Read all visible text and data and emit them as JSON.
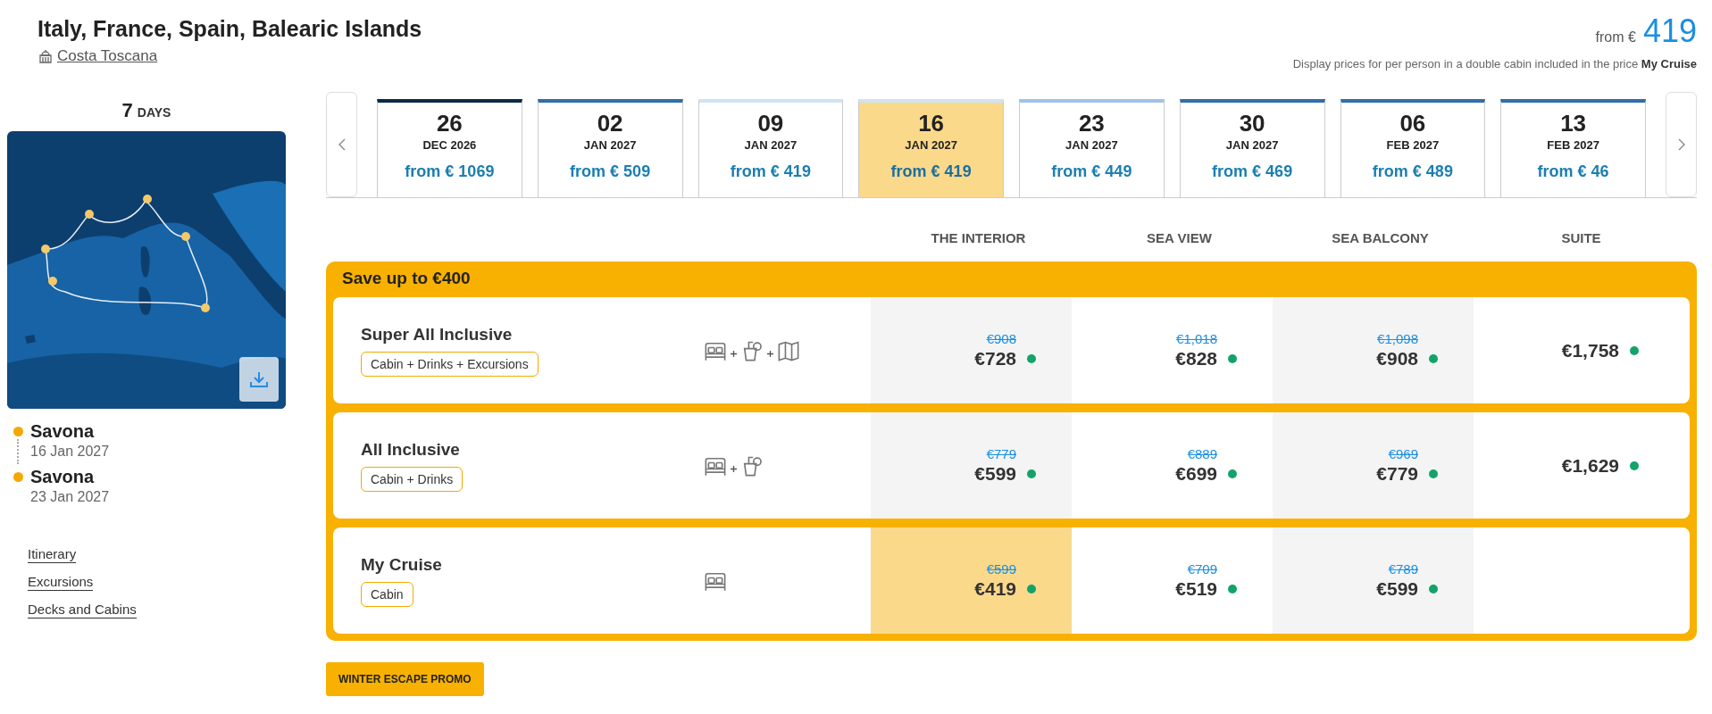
{
  "header": {
    "title": "Italy, France, Spain, Balearic Islands",
    "ship": "Costa Toscana",
    "price_prefix": "from €",
    "price": "419",
    "note": "Display prices for per person in a double cabin included in the price **My Cruise**"
  },
  "duration": {
    "number": "7",
    "unit": "DAYS"
  },
  "stops": [
    {
      "name": "Savona",
      "date": "16 Jan 2027"
    },
    {
      "name": "Savona",
      "date": "23 Jan 2027"
    }
  ],
  "links": [
    "Itinerary",
    "Excursions",
    "Decks and Cabins"
  ],
  "dates": [
    {
      "day": "26",
      "month": "DEC 2026",
      "price": "from € 1069",
      "color": "#0b2a45",
      "selected": false
    },
    {
      "day": "02",
      "month": "JAN 2027",
      "price": "from € 509",
      "color": "#2f6ea8",
      "selected": false
    },
    {
      "day": "09",
      "month": "JAN 2027",
      "price": "from € 419",
      "color": "#cfe3f2",
      "selected": false
    },
    {
      "day": "16",
      "month": "JAN 2027",
      "price": "from € 419",
      "color": "#cfe3f2",
      "selected": true
    },
    {
      "day": "23",
      "month": "JAN 2027",
      "price": "from € 449",
      "color": "#9fc3e6",
      "selected": false
    },
    {
      "day": "30",
      "month": "JAN 2027",
      "price": "from € 469",
      "color": "#2f6ea8",
      "selected": false
    },
    {
      "day": "06",
      "month": "FEB 2027",
      "price": "from € 489",
      "color": "#2f6ea8",
      "selected": false
    },
    {
      "day": "13",
      "month": "FEB 2027",
      "price": "from € 46",
      "color": "#2f6ea8",
      "selected": false
    }
  ],
  "cabin_columns": [
    "THE INTERIOR",
    "SEA VIEW",
    "SEA BALCONY",
    "SUITE"
  ],
  "offer": {
    "title": "Save up to €400"
  },
  "fares": [
    {
      "name": "Super All Inclusive",
      "tag": "Cabin + Drinks + Excursions",
      "icons": [
        {
          "kind": "bed"
        },
        {
          "kind": "drink"
        },
        {
          "kind": "map"
        }
      ],
      "prices": [
        {
          "old": "€908",
          "price": "€728",
          "available": true,
          "selected": false
        },
        {
          "old": "€1,018",
          "price": "€828",
          "available": true,
          "selected": false
        },
        {
          "old": "€1,098",
          "price": "€908",
          "available": true,
          "selected": false
        },
        {
          "price": "€1,758",
          "available": true,
          "selected": false
        }
      ]
    },
    {
      "name": "All Inclusive",
      "tag": "Cabin + Drinks",
      "icons": [
        {
          "kind": "bed"
        },
        {
          "kind": "drink"
        }
      ],
      "prices": [
        {
          "old": "€779",
          "price": "€599",
          "available": true,
          "selected": false
        },
        {
          "old": "€889",
          "price": "€699",
          "available": true,
          "selected": false
        },
        {
          "old": "€969",
          "price": "€779",
          "available": true,
          "selected": false
        },
        {
          "price": "€1,629",
          "available": true,
          "selected": false
        }
      ]
    },
    {
      "name": "My Cruise",
      "tag": "Cabin",
      "icons": [
        {
          "kind": "bed"
        }
      ],
      "prices": [
        {
          "old": "€599",
          "price": "€419",
          "available": true,
          "selected": true
        },
        {
          "old": "€709",
          "price": "€519",
          "available": true,
          "selected": false
        },
        {
          "old": "€789",
          "price": "€599",
          "available": true,
          "selected": false
        }
      ]
    }
  ],
  "promo_button": "WINTER ESCAPE PROMO"
}
